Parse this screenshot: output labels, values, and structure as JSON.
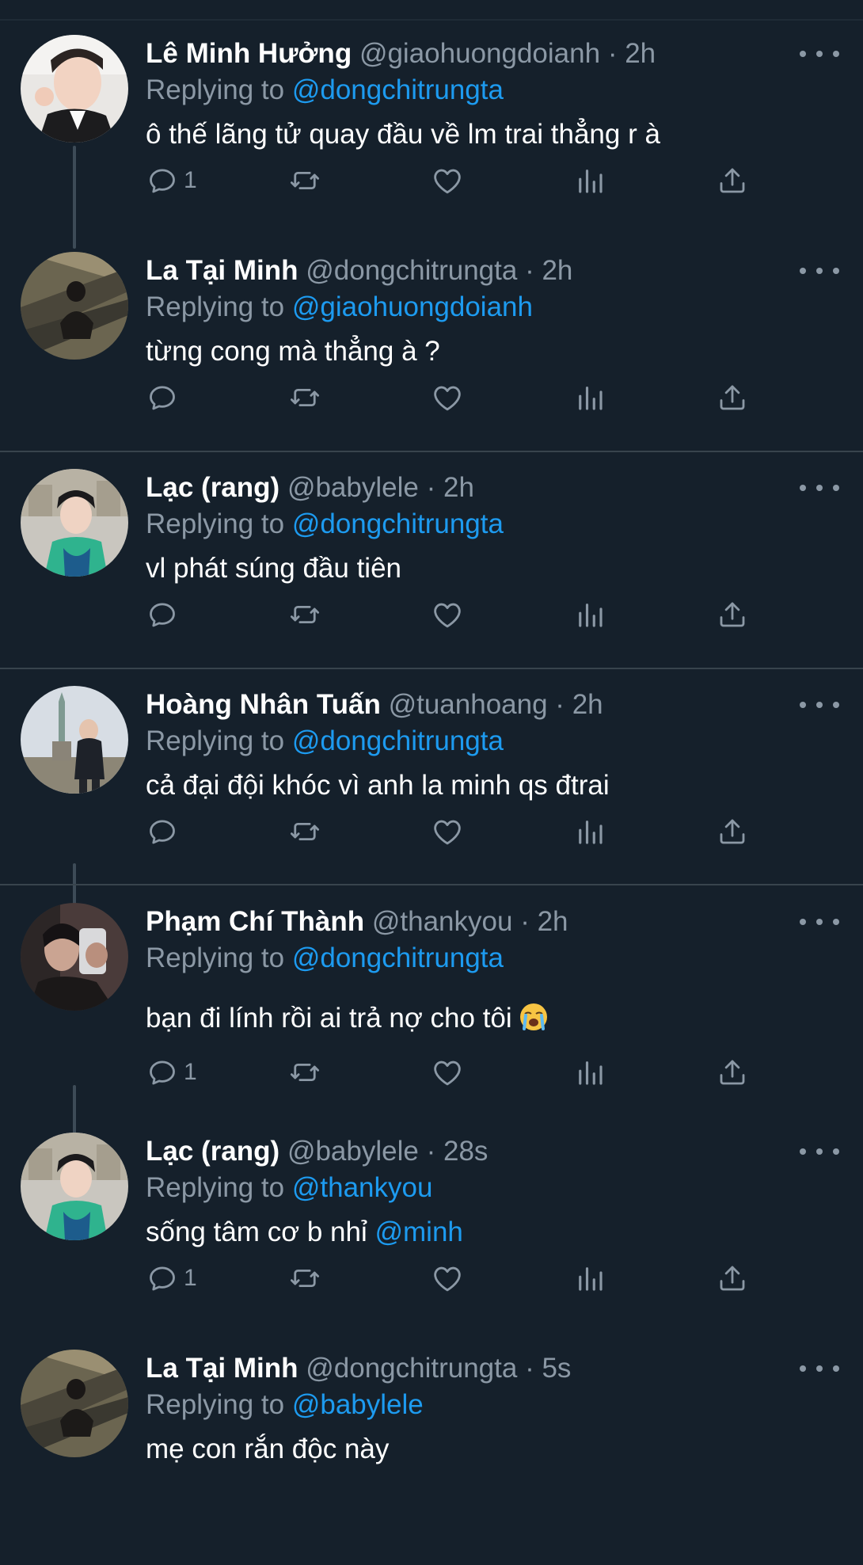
{
  "colors": {
    "background": "#15202b",
    "name_text": "#ffffff",
    "secondary_text": "#8b98a5",
    "link": "#1d9bf0",
    "divider": "#38444d",
    "thread_line": "#3d4b57"
  },
  "icons": {
    "more": "more-horizontal-icon",
    "reply": "reply-bubble-icon",
    "retweet": "retweet-icon",
    "like": "heart-icon",
    "views": "views-bar-chart-icon",
    "share": "share-upload-icon"
  },
  "replies": [
    {
      "name": "Lê Minh Hưởng",
      "handle": "@giaohuongdoianh",
      "time": "2h",
      "replying_label": "Replying to",
      "replying_to": "@dongchitrungta",
      "text": "ô thế lãng tử quay đầu về lm trai thẳng r à",
      "reply_count": "1"
    },
    {
      "name": "La Tại Minh",
      "handle": "@dongchitrungta",
      "time": "2h",
      "replying_label": "Replying to",
      "replying_to": "@giaohuongdoianh",
      "text": "từng cong mà thẳng à ?",
      "reply_count": ""
    },
    {
      "name": "Lạc (rang)",
      "handle": "@babylele",
      "time": "2h",
      "replying_label": "Replying to",
      "replying_to": "@dongchitrungta",
      "text": "vl phát súng đầu tiên",
      "reply_count": ""
    },
    {
      "name": "Hoàng Nhân Tuấn",
      "handle": "@tuanhoang",
      "time": "2h",
      "replying_label": "Replying to",
      "replying_to": "@dongchitrungta",
      "text": "cả đại đội khóc vì anh la minh qs đtrai",
      "reply_count": ""
    },
    {
      "name": "Phạm Chí Thành",
      "handle": "@thankyou",
      "time": "2h",
      "replying_label": "Replying to",
      "replying_to": "@dongchitrungta",
      "text": "bạn đi lính rồi ai trả nợ cho tôi",
      "emoji": "loudly-crying-face",
      "reply_count": "1"
    },
    {
      "name": "Lạc (rang)",
      "handle": "@babylele",
      "time": "28s",
      "replying_label": "Replying to",
      "replying_to": "@thankyou",
      "text": "sống tâm cơ b nhỉ",
      "mention": "@minh",
      "reply_count": "1"
    },
    {
      "name": "La Tại Minh",
      "handle": "@dongchitrungta",
      "time": "5s",
      "replying_label": "Replying to",
      "replying_to": "@babylele",
      "text": "mẹ con rắn độc này",
      "reply_count": ""
    }
  ]
}
